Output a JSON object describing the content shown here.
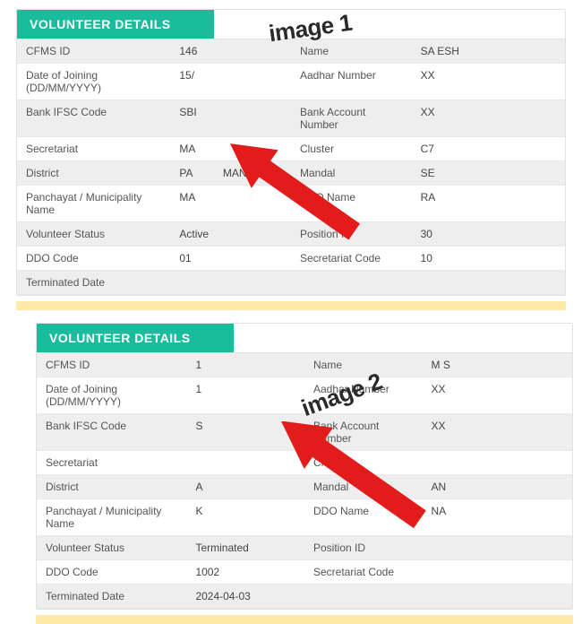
{
  "annotations": {
    "image1": "image 1",
    "image2": "image 2"
  },
  "header_title": "VOLUNTEER DETAILS",
  "labels": {
    "cfms": "CFMS ID",
    "name": "Name",
    "doj": "Date of Joining (DD/MM/YYYY)",
    "aadhar": "Aadhar Number",
    "ifsc": "Bank IFSC Code",
    "bankacct": "Bank Account Number",
    "secretariat": "Secretariat",
    "cluster": "Cluster",
    "district": "District",
    "mandal": "Mandal",
    "panchayat": "Panchayat / Municipality Name",
    "ddoname": "DDO Name",
    "volstatus": "Volunteer Status",
    "position": "Position ID",
    "ddocode": "DDO Code",
    "seccode": "Secretariat Code",
    "termdate": "Terminated Date"
  },
  "image1": {
    "cfms": "146",
    "name": "SA               ESH",
    "doj": "15/",
    "aadhar": "XX",
    "ifsc": "SBI",
    "bankacct": "XX",
    "secretariat": "MA",
    "cluster": "C7",
    "district": "PA",
    "district_extra": "MANYA",
    "mandal": "SE",
    "panchayat": "MA",
    "ddoname": "RA",
    "volstatus": "Active",
    "position": "30",
    "ddocode": "01",
    "seccode": "10",
    "termdate": ""
  },
  "image2": {
    "cfms": "1",
    "name": "M S",
    "doj": "1",
    "aadhar": "XX",
    "ifsc": "S",
    "bankacct": "XX",
    "secretariat": "",
    "cluster": "",
    "district": "A",
    "mandal": "AN",
    "panchayat": "K",
    "ddoname": "NA",
    "volstatus": "Terminated",
    "position": "",
    "ddocode": "1002",
    "seccode": "",
    "termdate": "2024-04-03"
  }
}
